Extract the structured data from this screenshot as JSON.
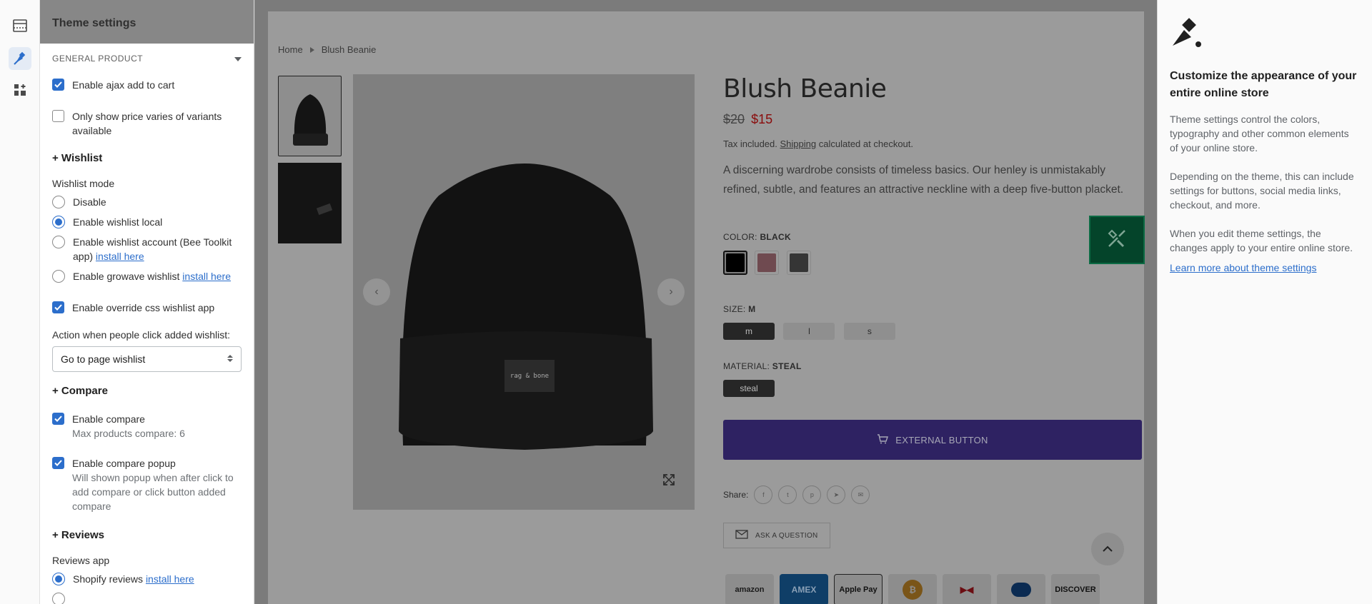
{
  "rail": {
    "items": [
      {
        "name": "sections-icon"
      },
      {
        "name": "theme-settings-icon"
      },
      {
        "name": "app-blocks-icon"
      }
    ]
  },
  "panel": {
    "title": "Theme settings",
    "section_title": "GENERAL PRODUCT",
    "ajax_label": "Enable ajax add to cart",
    "price_varies_label": "Only show price varies of variants available",
    "wishlist_heading": "+ Wishlist",
    "wishlist_mode_label": "Wishlist mode",
    "wishlist_options": [
      {
        "label": "Disable",
        "link": "",
        "checked": false
      },
      {
        "label": "Enable wishlist local",
        "link": "",
        "checked": true
      },
      {
        "label": "Enable wishlist account (Bee Toolkit app)",
        "link": "install here",
        "checked": false
      },
      {
        "label": "Enable growave wishlist",
        "link": "install here",
        "checked": false
      }
    ],
    "override_css_label": "Enable override css wishlist app",
    "action_label": "Action when people click added wishlist:",
    "action_value": "Go to page wishlist",
    "compare_heading": "+ Compare",
    "enable_compare_label": "Enable compare",
    "max_compare_label": "Max products compare: 6",
    "compare_popup_label": "Enable compare popup",
    "compare_popup_help": "Will shown popup when after click to add compare or click button added compare",
    "reviews_heading": "+ Reviews",
    "reviews_app_label": "Reviews app",
    "reviews_option_label": "Shopify reviews",
    "reviews_option_link": "install here"
  },
  "preview": {
    "breadcrumb_home": "Home",
    "breadcrumb_current": "Blush Beanie",
    "product_title": "Blush Beanie",
    "price_old": "$20",
    "price_new": "$15",
    "tax_prefix": "Tax included.",
    "tax_link": "Shipping",
    "tax_suffix": "calculated at checkout.",
    "description": "A discerning wardrobe consists of timeless basics. Our henley is unmistakably refined, subtle, and features an attractive neckline with a deep five-button placket.",
    "color_label": "COLOR:",
    "color_value": "BLACK",
    "color_swatches": [
      "#000000",
      "#d98b9a",
      "#4a4a4a"
    ],
    "size_label": "SIZE:",
    "size_value": "M",
    "sizes": [
      "m",
      "l",
      "s"
    ],
    "material_label": "MATERIAL:",
    "material_value": "STEAL",
    "material_option": "steal",
    "external_button": "EXTERNAL BUTTON",
    "share_label": "Share:",
    "share_icons": [
      "facebook-icon",
      "twitter-icon",
      "pinterest-icon",
      "telegram-icon",
      "email-icon"
    ],
    "ask_label": "ASK A QUESTION",
    "beanie_tag": "rag & bone",
    "payments": [
      "amazon",
      "AMEX",
      "Apple Pay",
      "bitcoin",
      "dankort",
      "diners",
      "DISCOVER"
    ]
  },
  "right": {
    "heading": "Customize the appearance of your entire online store",
    "p1": "Theme settings control the colors, typography and other common elements of your online store.",
    "p2": "Depending on the theme, this can include settings for buttons, social media links, checkout, and more.",
    "p3": "When you edit theme settings, the changes apply to your entire online store.",
    "learn_link": "Learn more about theme settings"
  },
  "colors": {
    "accent": "#2c6ecb",
    "external_button": "#2e2262",
    "tool_button": "#04442a"
  }
}
